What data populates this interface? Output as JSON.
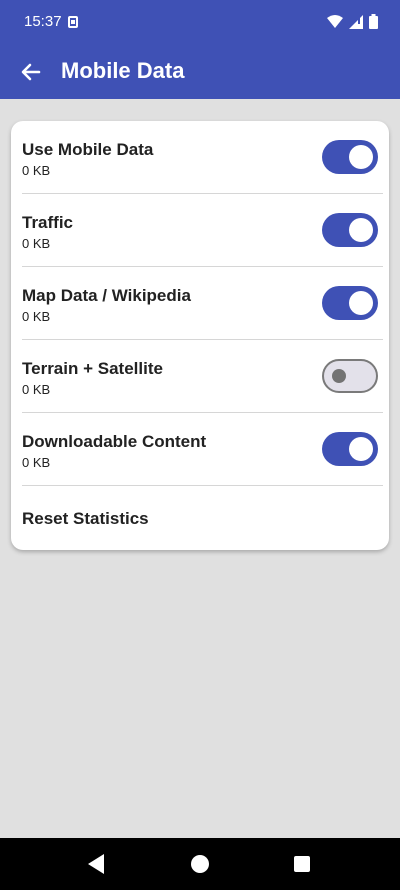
{
  "status_bar": {
    "time": "15:37"
  },
  "app_bar": {
    "title": "Mobile Data"
  },
  "settings": [
    {
      "label": "Use Mobile Data",
      "value": "0 KB",
      "enabled": true
    },
    {
      "label": "Traffic",
      "value": "0 KB",
      "enabled": true
    },
    {
      "label": "Map Data / Wikipedia",
      "value": "0 KB",
      "enabled": true
    },
    {
      "label": "Terrain + Satellite",
      "value": "0 KB",
      "enabled": false
    },
    {
      "label": "Downloadable Content",
      "value": "0 KB",
      "enabled": true
    }
  ],
  "reset_label": "Reset Statistics",
  "colors": {
    "primary": "#3f51b5",
    "background": "#e0e0e0",
    "card": "#ffffff"
  },
  "icons": {
    "back": "arrow-back-icon",
    "wifi": "wifi-icon",
    "signal": "cell-signal-icon",
    "battery": "battery-icon",
    "nav_back": "triangle-back-icon",
    "nav_home": "circle-home-icon",
    "nav_recents": "square-recents-icon"
  }
}
